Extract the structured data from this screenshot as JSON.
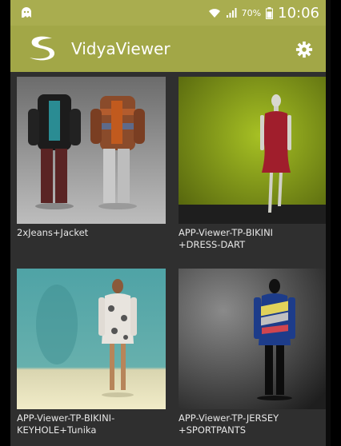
{
  "status_bar": {
    "battery_percent": "70%",
    "time": "10:06",
    "icons": [
      "ghost-icon",
      "wifi-icon",
      "signal-icon",
      "battery-icon"
    ]
  },
  "app_bar": {
    "title": "VidyaViewer",
    "logo_icon": "vidya-logo-icon",
    "settings_icon": "gear-icon"
  },
  "colors": {
    "status_bar": "#a9ad4f",
    "app_bar": "#a2a747",
    "background": "#2f2f2f",
    "caption_text": "#e6e6e6"
  },
  "items": [
    {
      "title": "2xJeans+Jacket"
    },
    {
      "title": "APP-Viewer-TP-BIKINI\n+DRESS-DART"
    },
    {
      "title": "APP-Viewer-TP-BIKINI-\nKEYHOLE+Tunika"
    },
    {
      "title": "APP-Viewer-TP-JERSEY\n+SPORTPANTS"
    }
  ]
}
